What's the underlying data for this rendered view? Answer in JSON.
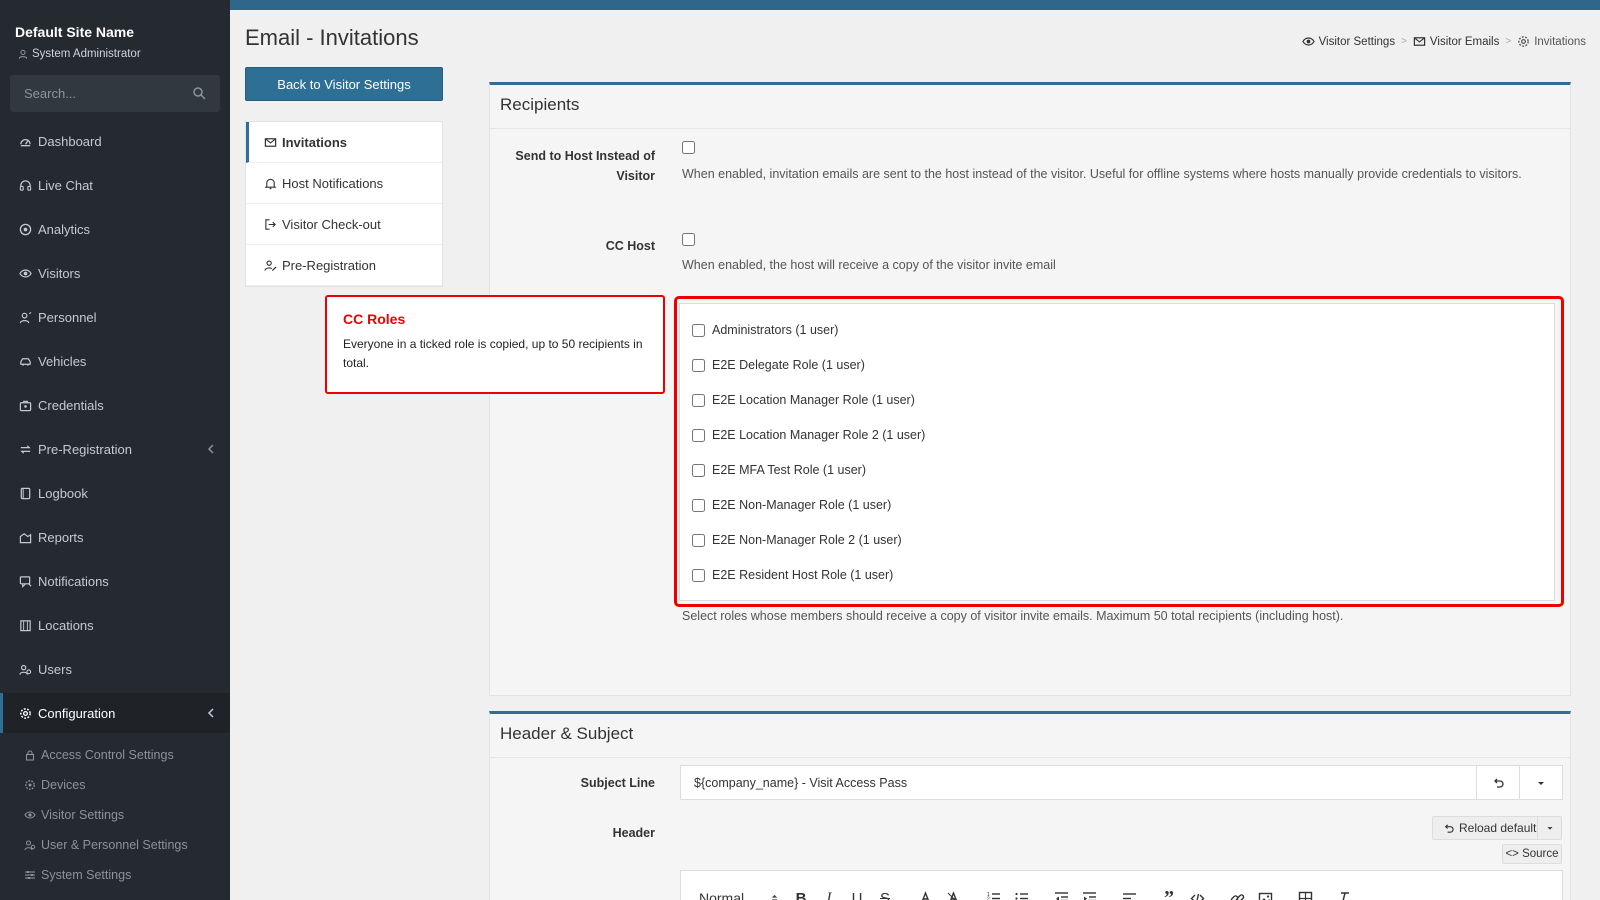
{
  "sidebar": {
    "site_name": "Default Site Name",
    "user_role": "System Administrator",
    "search_placeholder": "Search...",
    "items": [
      {
        "label": "Dashboard",
        "icon": "dashboard-icon"
      },
      {
        "label": "Live Chat",
        "icon": "headset-icon"
      },
      {
        "label": "Analytics",
        "icon": "analytics-icon"
      },
      {
        "label": "Visitors",
        "icon": "eye-icon"
      },
      {
        "label": "Personnel",
        "icon": "personnel-icon"
      },
      {
        "label": "Vehicles",
        "icon": "car-icon"
      },
      {
        "label": "Credentials",
        "icon": "credentials-icon"
      },
      {
        "label": "Pre-Registration",
        "icon": "pre-registration-icon"
      },
      {
        "label": "Logbook",
        "icon": "book-icon"
      },
      {
        "label": "Reports",
        "icon": "reports-icon"
      },
      {
        "label": "Notifications",
        "icon": "notifications-icon"
      },
      {
        "label": "Locations",
        "icon": "building-icon"
      },
      {
        "label": "Users",
        "icon": "users-icon"
      },
      {
        "label": "Configuration",
        "icon": "gear-icon"
      }
    ],
    "sub_items": [
      {
        "label": "Access Control Settings",
        "icon": "lock-icon"
      },
      {
        "label": "Devices",
        "icon": "devices-icon"
      },
      {
        "label": "Visitor Settings",
        "icon": "eye-icon"
      },
      {
        "label": "User & Personnel Settings",
        "icon": "users-icon"
      },
      {
        "label": "System Settings",
        "icon": "sliders-icon"
      }
    ]
  },
  "page": {
    "title": "Email - Invitations",
    "breadcrumbs": [
      "Visitor Settings",
      "Visitor Emails",
      "Invitations"
    ]
  },
  "left_nav": {
    "back_button": "Back to Visitor Settings",
    "items": [
      "Invitations",
      "Host Notifications",
      "Visitor Check-out",
      "Pre-Registration"
    ]
  },
  "recipients": {
    "heading": "Recipients",
    "send_to_host_label": "Send to Host Instead of Visitor",
    "send_to_host_help": "When enabled, invitation emails are sent to the host instead of the visitor. Useful for offline systems where hosts manually provide credentials to visitors.",
    "cc_host_label": "CC Host",
    "cc_host_help": "When enabled, the host will receive a copy of the visitor invite email",
    "roles": [
      "Administrators (1 user)",
      "E2E Delegate Role (1 user)",
      "E2E Location Manager Role (1 user)",
      "E2E Location Manager Role 2 (1 user)",
      "E2E MFA Test Role (1 user)",
      "E2E Non-Manager Role (1 user)",
      "E2E Non-Manager Role 2 (1 user)",
      "E2E Resident Host Role (1 user)"
    ],
    "roles_help": "Select roles whose members should receive a copy of visitor invite emails. Maximum 50 total recipients (including host)."
  },
  "callout": {
    "title": "CC Roles",
    "body": "Everyone in a ticked role is copied, up to 50 recipients in total."
  },
  "header_subject": {
    "heading": "Header & Subject",
    "subject_label": "Subject Line",
    "subject_value": "${company_name} - Visit Access Pass",
    "header_label": "Header",
    "reload_default": "Reload default",
    "source": "<> Source",
    "format_select": "Normal"
  },
  "colors": {
    "sidebar_bg": "#252a30",
    "accent": "#2e6f96",
    "highlight": "#ee0000"
  }
}
